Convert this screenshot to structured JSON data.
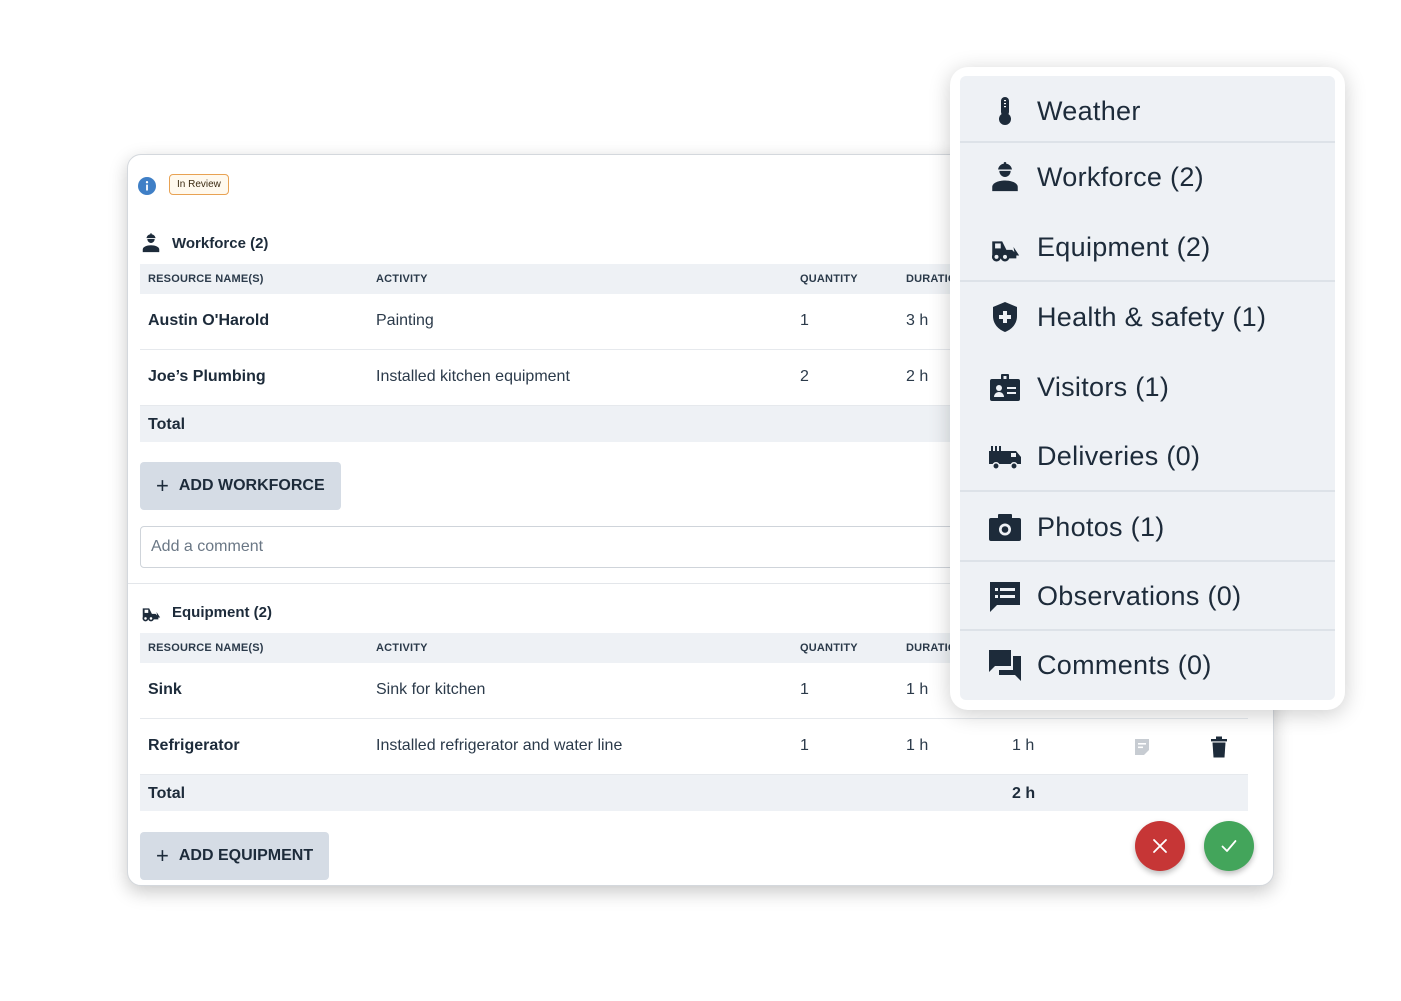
{
  "status": {
    "badge": "In Review"
  },
  "workforce": {
    "title": "Workforce (2)",
    "columns": [
      "RESOURCE NAME(S)",
      "ACTIVITY",
      "QUANTITY",
      "DURATIO"
    ],
    "rows": [
      {
        "name": "Austin O'Harold",
        "activity": "Painting",
        "quantity": "1",
        "duration": "3 h"
      },
      {
        "name": "Joe’s Plumbing",
        "activity": "Installed kitchen equipment",
        "quantity": "2",
        "duration": "2 h"
      }
    ],
    "total_label": "Total",
    "add_button": "ADD WORKFORCE",
    "comment_placeholder": "Add a comment"
  },
  "equipment": {
    "title": "Equipment (2)",
    "columns": [
      "RESOURCE NAME(S)",
      "ACTIVITY",
      "QUANTITY",
      "DURATIO"
    ],
    "rows": [
      {
        "name": "Sink",
        "activity": "Sink for kitchen",
        "quantity": "1",
        "duration": "1 h"
      },
      {
        "name": "Refrigerator",
        "activity": "Installed refrigerator and water line",
        "quantity": "1",
        "duration": "1 h",
        "total": "1 h"
      }
    ],
    "total_label": "Total",
    "total_value": "2 h",
    "add_button": "ADD EQUIPMENT"
  },
  "menu": {
    "items": [
      {
        "label": "Weather",
        "icon": "thermometer-icon"
      },
      {
        "label": "Workforce (2)",
        "icon": "worker-icon"
      },
      {
        "label": "Equipment (2)",
        "icon": "bulldozer-icon"
      },
      {
        "label": "Health & safety (1)",
        "icon": "shield-plus-icon"
      },
      {
        "label": "Visitors (1)",
        "icon": "badge-icon"
      },
      {
        "label": "Deliveries (0)",
        "icon": "truck-icon"
      },
      {
        "label": "Photos (1)",
        "icon": "camera-icon"
      },
      {
        "label": "Observations (0)",
        "icon": "list-message-icon"
      },
      {
        "label": "Comments (0)",
        "icon": "chat-icon"
      }
    ]
  },
  "colors": {
    "text": "#1d2b3a",
    "header_bg": "#eef1f5",
    "button_bg": "#d5dce5",
    "badge_border": "#e8a253",
    "info_blue": "#3f7fc6",
    "cancel_red": "#c63636",
    "confirm_green": "#43a55b"
  }
}
